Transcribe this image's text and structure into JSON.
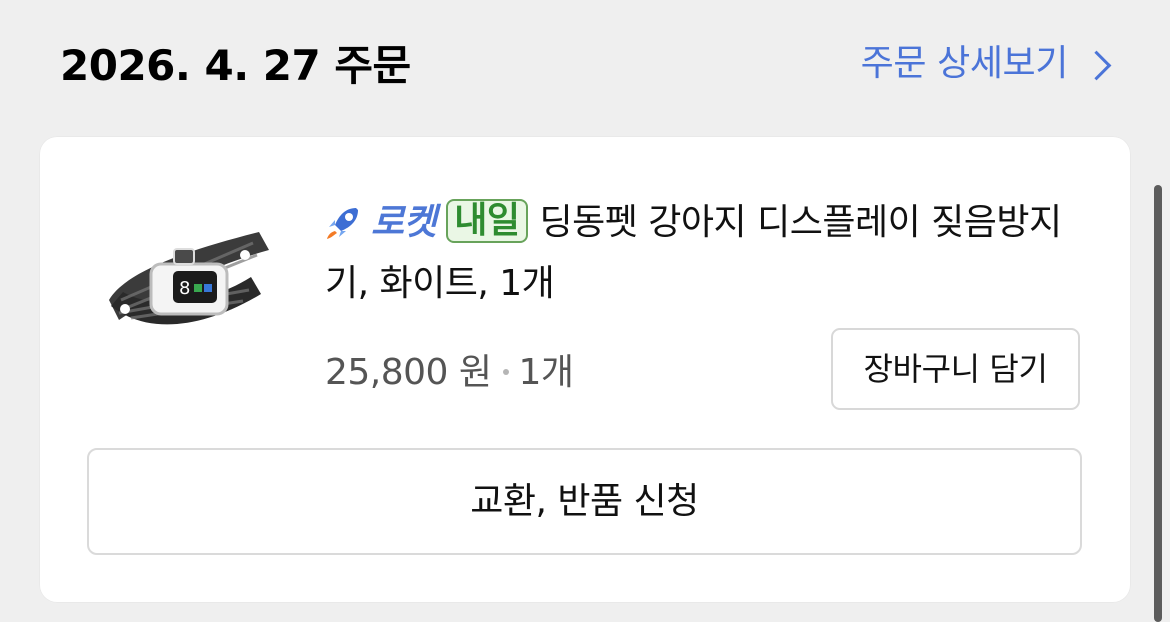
{
  "order": {
    "date": "2026. 4. 27 주문",
    "detail_link_label": "주문 상세보기"
  },
  "product": {
    "rocket_label": "로켓",
    "badge_label": "내일",
    "name": "딩동펫 강아지 디스플레이 짖음방지기, 화이트, 1개",
    "price": "25,800 원",
    "quantity": "1개",
    "image_icon": "dog-collar-product-icon"
  },
  "actions": {
    "add_to_cart_label": "장바구니 담기",
    "return_label": "교환, 반품 신청"
  },
  "colors": {
    "accent_blue": "#4b74d8",
    "badge_green": "#2e8c30"
  }
}
